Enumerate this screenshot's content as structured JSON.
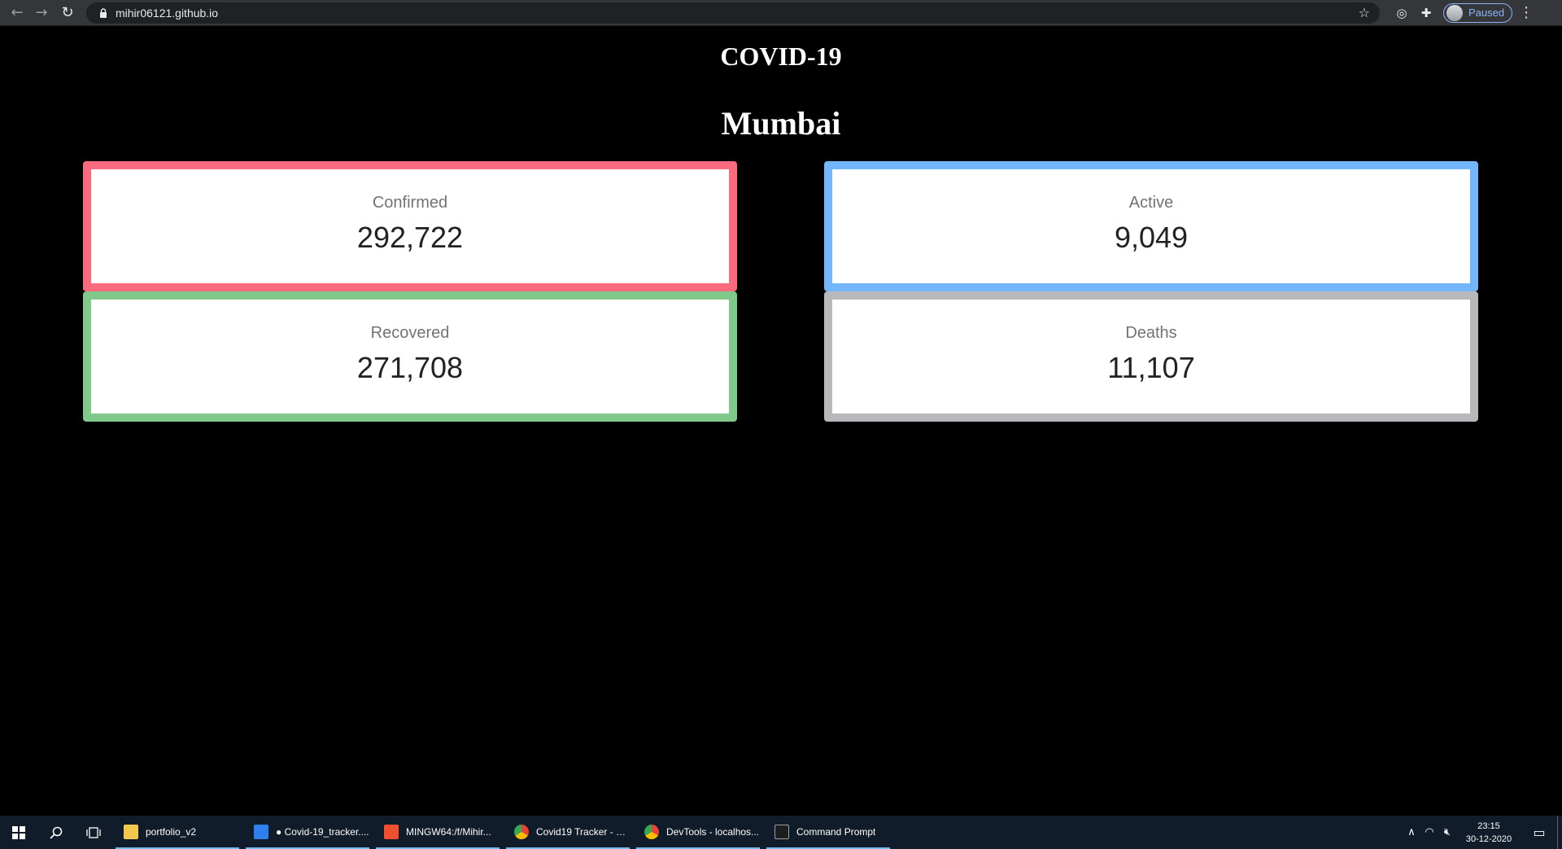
{
  "browser": {
    "url": "mihir06121.github.io",
    "profile_status": "Paused",
    "icons": {
      "back": "back-arrow-icon",
      "forward": "forward-arrow-icon",
      "reload": "reload-icon",
      "lock": "lock-icon",
      "bookmark": "star-icon",
      "extension_target": "target-icon",
      "extensions": "puzzle-icon",
      "menu": "kebab-menu-icon"
    }
  },
  "page": {
    "title": "COVID-19",
    "city": "Mumbai",
    "stats": {
      "confirmed": {
        "label": "Confirmed",
        "value": "292,722",
        "color": "#fa6b80"
      },
      "active": {
        "label": "Active",
        "value": "9,049",
        "color": "#74b6fb"
      },
      "recovered": {
        "label": "Recovered",
        "value": "271,708",
        "color": "#80c98b"
      },
      "deaths": {
        "label": "Deaths",
        "value": "11,107",
        "color": "#b6b8bb"
      }
    }
  },
  "taskbar": {
    "apps": [
      {
        "label": "portfolio_v2",
        "icon": "folder-icon",
        "color": "#f2c94c"
      },
      {
        "label": "● Covid-19_tracker....",
        "icon": "vscode-icon",
        "color": "#2f80ed"
      },
      {
        "label": "MINGW64:/f/Mihir...",
        "icon": "git-bash-icon",
        "color": "#f05032"
      },
      {
        "label": "Covid19 Tracker - G...",
        "icon": "chrome-icon",
        "color": "#34a853"
      },
      {
        "label": "DevTools - localhos...",
        "icon": "chrome-icon",
        "color": "#34a853"
      },
      {
        "label": "Command Prompt",
        "icon": "cmd-icon",
        "color": "#1e1e1e"
      }
    ],
    "time": "23:15",
    "date": "30-12-2020"
  }
}
